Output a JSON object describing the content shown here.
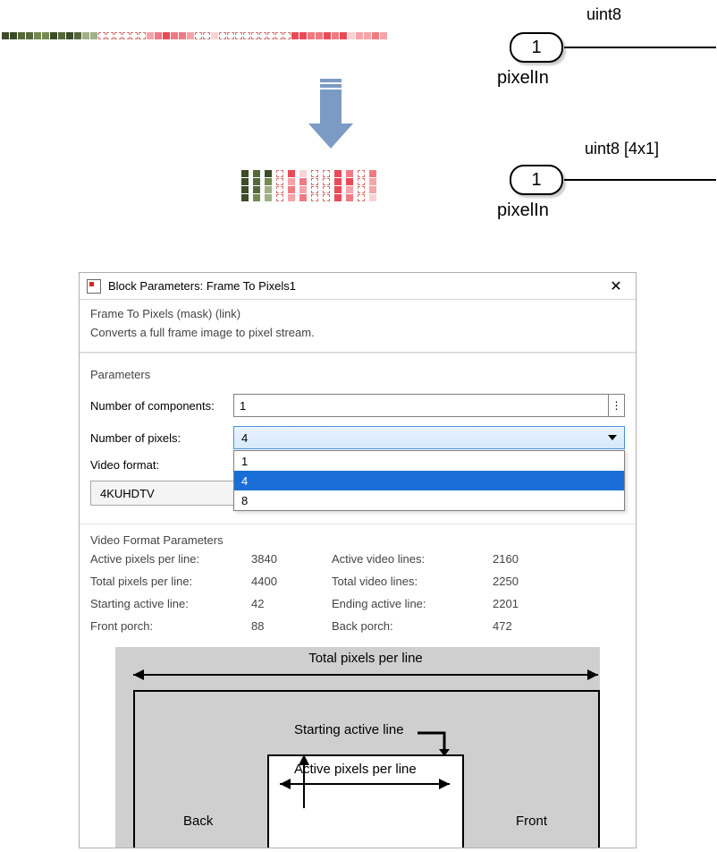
{
  "inport1": {
    "num": "1",
    "type": "uint8",
    "name": "pixelIn"
  },
  "inport2": {
    "num": "1",
    "type": "uint8 [4x1]",
    "name": "pixelIn"
  },
  "dialog": {
    "title": "Block Parameters: Frame To Pixels1",
    "mask_title": "Frame To Pixels (mask) (link)",
    "mask_desc": "Converts a full frame image to pixel stream.",
    "parameters_label": "Parameters",
    "num_components_label": "Number of components:",
    "num_components_value": "1",
    "num_pixels_label": "Number of pixels:",
    "num_pixels_value": "4",
    "num_pixels_options": [
      "1",
      "4",
      "8"
    ],
    "video_format_label": "Video format:",
    "video_format_value": "4KUHDTV",
    "vfp_title": "Video Format Parameters",
    "vfp": {
      "apl_label": "Active pixels per line:",
      "apl": "3840",
      "avl_label": "Active video lines:",
      "avl": "2160",
      "tpl_label": "Total pixels per line:",
      "tpl": "4400",
      "tvl_label": "Total video lines:",
      "tvl": "2250",
      "sal_label": "Starting active line:",
      "sal": "42",
      "eal_label": "Ending active line:",
      "eal": "2201",
      "fp_label": "Front porch:",
      "fp": "88",
      "bp_label": "Back porch:",
      "bp": "472"
    },
    "diagram": {
      "top": "Total pixels per line",
      "sal": "Starting active line",
      "apl": "Active pixels per line",
      "back": "Back",
      "front": "Front"
    }
  }
}
